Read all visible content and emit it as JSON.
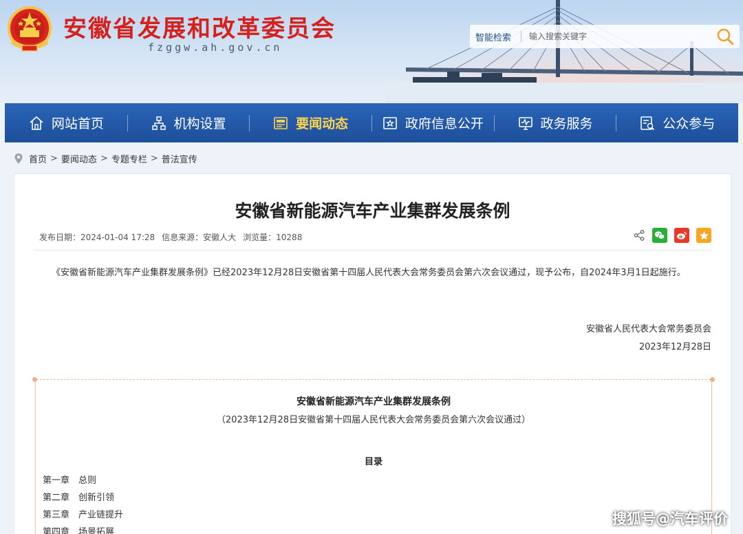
{
  "header": {
    "title": "安徽省发展和改革委员会",
    "domain": "fzggw.ah.gov.cn",
    "emblem_icon": "national-emblem-icon",
    "search": {
      "label": "智能检索",
      "placeholder": "输入搜索关键字",
      "button_icon": "search-icon"
    }
  },
  "nav": {
    "items": [
      {
        "label": "网站首页",
        "icon": "home-icon",
        "active": false
      },
      {
        "label": "机构设置",
        "icon": "org-chart-icon",
        "active": false
      },
      {
        "label": "要闻动态",
        "icon": "news-icon",
        "active": true
      },
      {
        "label": "政府信息公开",
        "icon": "info-disclosure-icon",
        "active": false
      },
      {
        "label": "政务服务",
        "icon": "service-monitor-icon",
        "active": false
      },
      {
        "label": "公众参与",
        "icon": "participation-icon",
        "active": false
      }
    ]
  },
  "breadcrumb": {
    "items": [
      "首页",
      "要闻动态",
      "专题专栏",
      "普法宣传"
    ],
    "separator": ">"
  },
  "article": {
    "title": "安徽省新能源汽车产业集群发展条例",
    "meta": {
      "date": "发布日期：2024-01-04 17:28",
      "source": "信息来源：安徽人大",
      "views": "浏览量：10288"
    },
    "share": [
      "share-icon",
      "wechat-icon",
      "weibo-icon",
      "favorite-icon"
    ],
    "body": "《安徽省新能源汽车产业集群发展条例》已经2023年12月28日安徽省第十四届人民代表大会常务委员会第六次会议通过，现予公布，自2024年3月1日起施行。",
    "signature_org": "安徽省人民代表大会常务委员会",
    "signature_date": "2023年12月28日",
    "document": {
      "title": "安徽省新能源汽车产业集群发展条例",
      "subtitle": "（2023年12月28日安徽省第十四届人民代表大会常务委员会第六次会议通过）",
      "toc_heading": "目录",
      "toc": [
        {
          "chapter": "第一章",
          "name": "总则"
        },
        {
          "chapter": "第二章",
          "name": "创新引领"
        },
        {
          "chapter": "第三章",
          "name": "产业链提升"
        },
        {
          "chapter": "第四章",
          "name": "场景拓展"
        }
      ]
    }
  },
  "watermark": "搜狐号@汽车评价",
  "colors": {
    "brand_red": "#d6201c",
    "nav_blue": "#1d4f9a",
    "nav_active": "#ffd34a",
    "wechat": "#2aae3a",
    "weibo": "#e6392b",
    "favorite": "#f5a623"
  }
}
